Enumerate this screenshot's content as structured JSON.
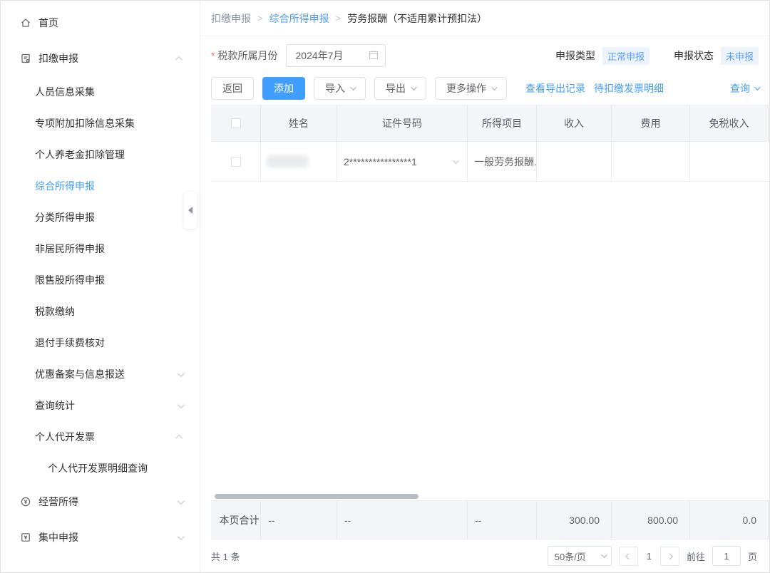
{
  "sidebar": {
    "items": [
      {
        "label": "首页"
      },
      {
        "label": "扣缴申报"
      },
      {
        "label": "人员信息采集"
      },
      {
        "label": "专项附加扣除信息采集"
      },
      {
        "label": "个人养老金扣除管理"
      },
      {
        "label": "综合所得申报"
      },
      {
        "label": "分类所得申报"
      },
      {
        "label": "非居民所得申报"
      },
      {
        "label": "限售股所得申报"
      },
      {
        "label": "税款缴纳"
      },
      {
        "label": "退付手续费核对"
      },
      {
        "label": "优惠备案与信息报送"
      },
      {
        "label": "查询统计"
      },
      {
        "label": "个人代开发票"
      },
      {
        "label": "个人代开发票明细查询"
      },
      {
        "label": "经营所得"
      },
      {
        "label": "集中申报"
      }
    ]
  },
  "breadcrumb": {
    "sep": ">",
    "items": [
      {
        "label": "扣缴申报"
      },
      {
        "label": "综合所得申报"
      },
      {
        "label": "劳务报酬（不适用累计预扣法）"
      }
    ]
  },
  "filter": {
    "required_mark": "*",
    "label": "税款所属月份",
    "value": "2024年7月"
  },
  "status": {
    "type_label": "申报类型",
    "type_value": "正常申报",
    "state_label": "申报状态",
    "state_value": "未申报"
  },
  "toolbar": {
    "back": "返回",
    "add": "添加",
    "import": "导入",
    "export": "导出",
    "more": "更多操作",
    "view_export_records": "查看导出记录",
    "pending_withholding_invoices": "待扣缴发票明细",
    "query": "查询"
  },
  "table": {
    "columns": [
      "姓名",
      "证件号码",
      "所得项目",
      "收入",
      "费用",
      "免税收入"
    ],
    "row": {
      "cert_number": "2****************1",
      "income_item": "一般劳务报酬...",
      "income": "",
      "fee": "",
      "tax_free": ""
    },
    "summary": {
      "label": "本页合计",
      "name": "--",
      "cert_number": "--",
      "income_item": "--",
      "income": "300.00",
      "fee": "800.00",
      "tax_free": "0.0"
    }
  },
  "pagination": {
    "total": "共 1 条",
    "page_size": "50条/页",
    "current_page": "1",
    "goto_label": "前往",
    "goto_value": "1",
    "page_unit": "页"
  },
  "colors": {
    "primary": "#409eff",
    "badge_bg": "#ecf3fb",
    "header_bg": "#f3f5f8"
  }
}
